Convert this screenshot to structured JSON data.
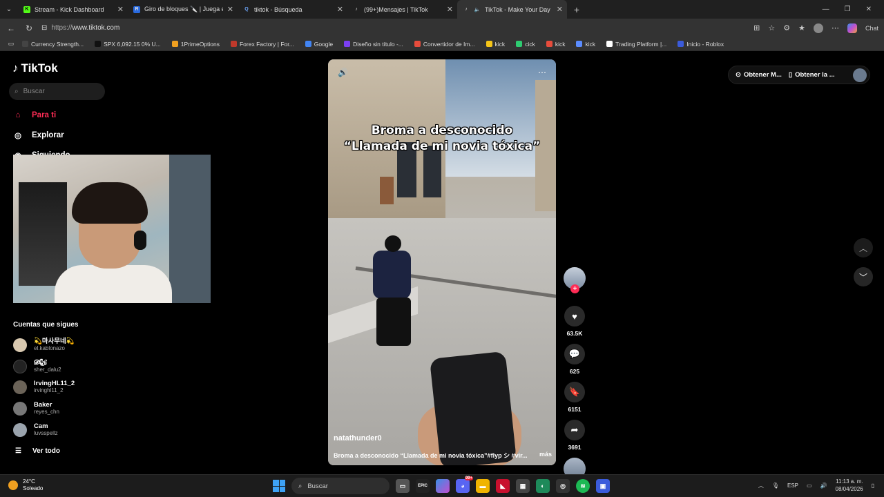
{
  "browser": {
    "tabs": [
      {
        "title": "Stream - Kick Dashboard",
        "color": "#53fc18",
        "glyph": "K"
      },
      {
        "title": "Giro de bloques 🔪 | Juega en Ro",
        "color": "#2a6be0",
        "glyph": "R"
      },
      {
        "title": "tiktok - Búsqueda",
        "color": "#3b82f6",
        "glyph": "Q"
      },
      {
        "title": "(99+)Mensajes | TikTok",
        "color": "#000000",
        "glyph": "♪"
      },
      {
        "title": "TikTok - Make Your Day",
        "color": "#000000",
        "glyph": "♪"
      }
    ],
    "url_proto": "https://",
    "url_host": "www.tiktok.com",
    "chat_label": "Chat",
    "bookmarks": [
      {
        "label": "Currency Strength...",
        "color": "#444"
      },
      {
        "label": "SPX 6,092.15 0% U...",
        "color": "#111"
      },
      {
        "label": "1PrimeOptions",
        "color": "#f0a020"
      },
      {
        "label": "Forex Factory | For...",
        "color": "#c0392b"
      },
      {
        "label": "Google",
        "color": "#4285f4"
      },
      {
        "label": "Diseño sin título -...",
        "color": "#7b3ff2"
      },
      {
        "label": "Convertidor de Im...",
        "color": "#e74c3c"
      },
      {
        "label": "kick",
        "color": "#f5c518"
      },
      {
        "label": "cick",
        "color": "#2ecc71"
      },
      {
        "label": "kick",
        "color": "#e74c3c"
      },
      {
        "label": "kick",
        "color": "#5b8cff"
      },
      {
        "label": "Trading Platform |...",
        "color": "#ffffff"
      },
      {
        "label": "Inicio - Roblox",
        "color": "#3b5bdb"
      }
    ]
  },
  "tiktok": {
    "logo": "TikTok",
    "search_placeholder": "Buscar",
    "nav": [
      {
        "label": "Para ti"
      },
      {
        "label": "Explorar"
      },
      {
        "label": "Siguiendo"
      }
    ],
    "following_title": "Cuentas que sigues",
    "accounts": [
      {
        "name": "💫마사무네💫",
        "handle": "el.kablonazo"
      },
      {
        "name": "𝓓🐿",
        "handle": "sher_dalu2"
      },
      {
        "name": "IrvingHL11_2",
        "handle": "irvinghl11_2"
      },
      {
        "name": "Baker",
        "handle": "reyes_chn"
      },
      {
        "name": "Cam",
        "handle": "luvsspellz"
      }
    ],
    "see_all": "Ver todo",
    "top_right": {
      "item1": "Obtener M...",
      "item2": "Obtener la ..."
    }
  },
  "video": {
    "caption_line1": "Broma a desconocido",
    "caption_line2": "“Llamada de mi novia tóxica”",
    "author": "natathunder0",
    "description": "Broma a desconocido “Llamada de mi novia tóxica”#flyp シ #vir...",
    "more": "más",
    "likes": "63.5K",
    "comments": "625",
    "saves": "6151",
    "shares": "3691"
  },
  "taskbar": {
    "temp": "24°C",
    "weather": "Soleado",
    "search": "Buscar",
    "lang": "ESP",
    "time": "11:13 a. m.",
    "date": "08/04/2026",
    "badge": "99+"
  }
}
